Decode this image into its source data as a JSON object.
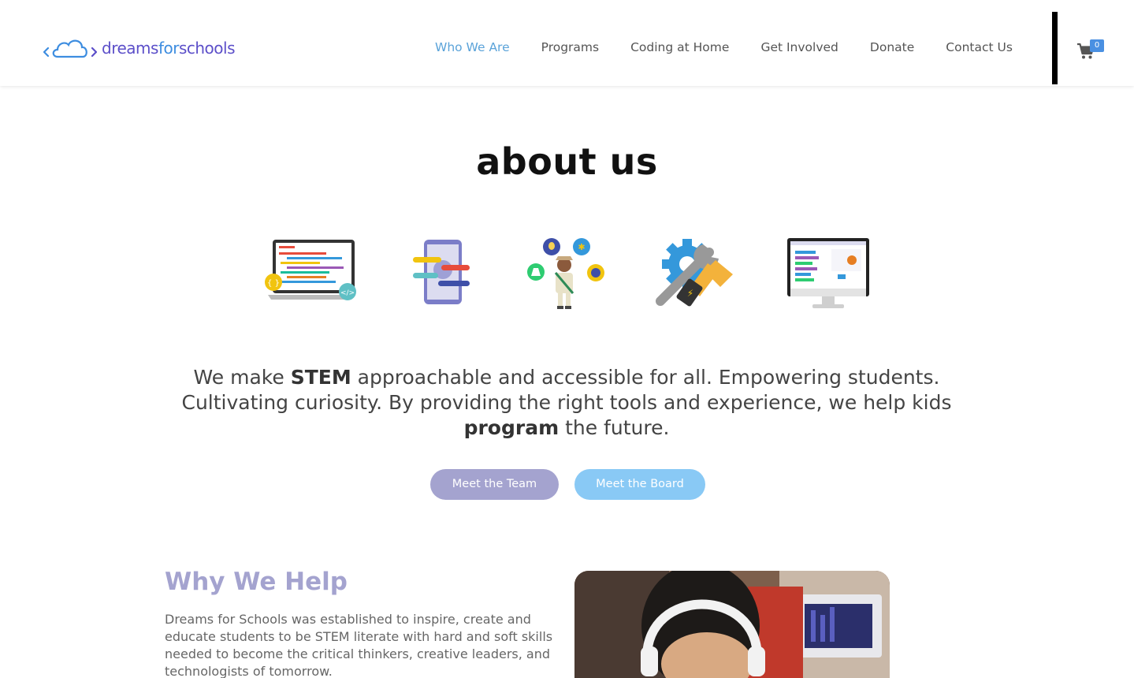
{
  "header": {
    "logo": {
      "part1": "dreams",
      "part2": "for",
      "part3": "schools"
    },
    "nav": [
      {
        "label": "Who We Are",
        "active": true
      },
      {
        "label": "Programs",
        "active": false
      },
      {
        "label": "Coding at Home",
        "active": false
      },
      {
        "label": "Get Involved",
        "active": false
      },
      {
        "label": "Donate",
        "active": false
      },
      {
        "label": "Contact Us",
        "active": false
      }
    ],
    "cart_count": "0"
  },
  "about": {
    "title": "about us",
    "icons": [
      "laptop-code-icon",
      "mobile-blocks-icon",
      "student-explorer-icon",
      "tools-gear-icon",
      "monitor-scratch-icon"
    ],
    "mission": {
      "p1": "We make ",
      "b1": "STEM",
      "p2": " approachable and accessible for all. Empowering students. Cultivating curiosity. By providing the right tools and experience, we help kids ",
      "b2": "program",
      "p3": " the future."
    },
    "buttons": {
      "team": "Meet the Team",
      "board": "Meet the Board"
    }
  },
  "why": {
    "title": "Why We Help",
    "text": "Dreams for Schools was established to inspire, create and educate students to be STEM literate with hard and soft skills needed to become the critical thinkers, creative leaders, and technologists of tomorrow."
  },
  "colors": {
    "accent_purple": "#a4a3cf",
    "accent_blue": "#89c9f5",
    "nav_active": "#5ba3d9"
  }
}
